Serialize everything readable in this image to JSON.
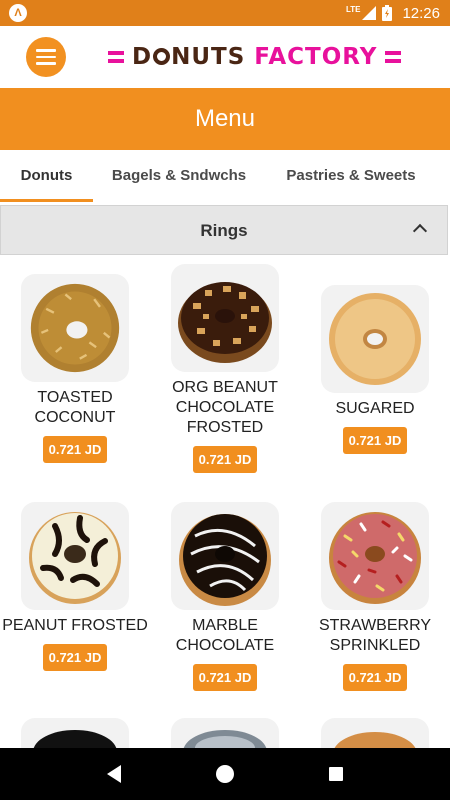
{
  "status_bar": {
    "network": "LTE",
    "time": "12:26"
  },
  "app_bar": {
    "brand": "DONUTS FACTORY"
  },
  "title": "Menu",
  "tabs": [
    {
      "label": "Donuts",
      "selected": true
    },
    {
      "label": "Bagels & Sndwchs",
      "selected": false
    },
    {
      "label": "Pastries & Sweets",
      "selected": false
    }
  ],
  "section": {
    "title": "Rings",
    "expanded": true
  },
  "items": [
    {
      "name": "TOASTED COCONUT",
      "price": "0.721 JD"
    },
    {
      "name": "ORG BEANUT CHOCOLATE FROSTED",
      "price": "0.721 JD"
    },
    {
      "name": "SUGARED",
      "price": "0.721 JD"
    },
    {
      "name": "PEANUT FROSTED",
      "price": "0.721 JD"
    },
    {
      "name": "MARBLE CHOCOLATE",
      "price": "0.721 JD"
    },
    {
      "name": "STRAWBERRY SPRINKLED",
      "price": "0.721 JD"
    }
  ],
  "colors": {
    "accent": "#f18f1f",
    "brand_pink": "#e8119c",
    "status_bar": "#e0801a"
  }
}
